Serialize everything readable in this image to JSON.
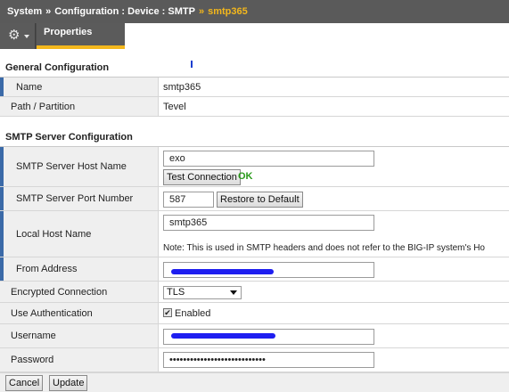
{
  "breadcrumb": {
    "root": "System",
    "sep": "»",
    "path": "Configuration : Device : SMTP",
    "current": "smtp365"
  },
  "toolbar": {
    "tab_properties": "Properties"
  },
  "general": {
    "title": "General Configuration",
    "name_label": "Name",
    "name_value": "smtp365",
    "partition_label": "Path / Partition",
    "partition_value": "Tevel"
  },
  "smtp": {
    "title": "SMTP Server Configuration",
    "host_label": "SMTP Server Host Name",
    "host_value": "exo",
    "test_button": "Test Connection",
    "test_status": "OK",
    "port_label": "SMTP Server Port Number",
    "port_value": "587",
    "restore_button": "Restore to Default",
    "local_host_label": "Local Host Name",
    "local_host_value": "smtp365",
    "local_host_note": "Note: This is used in SMTP headers and does not refer to the BIG-IP system's Ho",
    "from_label": "From Address",
    "encryption_label": "Encrypted Connection",
    "encryption_value": "TLS",
    "auth_label": "Use Authentication",
    "auth_enabled_label": "Enabled",
    "username_label": "Username",
    "password_label": "Password",
    "password_value": "••••••••••••••••••••••••••••"
  },
  "footer": {
    "cancel": "Cancel",
    "update": "Update"
  },
  "colors": {
    "accent": "#f3b71c",
    "ok": "#2a9a1b",
    "required_marker": "#3b6aa8",
    "redaction": "#1e1ef0"
  }
}
